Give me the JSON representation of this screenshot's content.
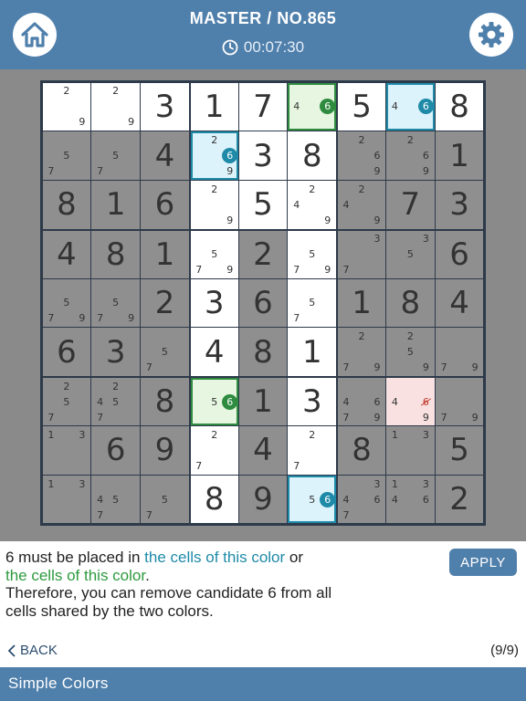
{
  "header": {
    "title": "MASTER / NO.865",
    "timer": "00:07:30",
    "home_icon": "home-icon",
    "settings_icon": "gear-icon"
  },
  "colors": {
    "header": "#4f7fab",
    "shaded_cell": "#8f8f8f",
    "white_cell": "#ffffff",
    "blue_cell": "#ddf3fb",
    "green_cell": "#e6f6e0",
    "red_cell": "#f9e1e1",
    "blue_chain": "#1f8aa8",
    "green_chain": "#2e8b3f"
  },
  "grid": [
    [
      {
        "v": "",
        "c": [
          "2",
          "9"
        ],
        "bg": "w"
      },
      {
        "v": "",
        "c": [
          "2",
          "9"
        ],
        "bg": "w"
      },
      {
        "v": "3",
        "bg": "w"
      },
      {
        "v": "1",
        "bg": "w"
      },
      {
        "v": "7",
        "bg": "w"
      },
      {
        "v": "",
        "c": [
          "4",
          "6"
        ],
        "bg": "g",
        "hl": "6",
        "hlc": "green"
      },
      {
        "v": "5",
        "bg": "w"
      },
      {
        "v": "",
        "c": [
          "4",
          "6"
        ],
        "bg": "b",
        "hl": "6",
        "hlc": "blue"
      },
      {
        "v": "8",
        "bg": "w"
      }
    ],
    [
      {
        "v": "",
        "c": [
          "5",
          "7"
        ],
        "bg": "s"
      },
      {
        "v": "",
        "c": [
          "5",
          "7"
        ],
        "bg": "s"
      },
      {
        "v": "4",
        "bg": "s"
      },
      {
        "v": "",
        "c": [
          "2",
          "6",
          "9"
        ],
        "bg": "b",
        "hl": "6",
        "hlc": "blue"
      },
      {
        "v": "3",
        "bg": "w"
      },
      {
        "v": "8",
        "bg": "w"
      },
      {
        "v": "",
        "c": [
          "2",
          "6",
          "9"
        ],
        "bg": "s"
      },
      {
        "v": "",
        "c": [
          "2",
          "6",
          "9"
        ],
        "bg": "s"
      },
      {
        "v": "1",
        "bg": "s"
      }
    ],
    [
      {
        "v": "8",
        "bg": "s"
      },
      {
        "v": "1",
        "bg": "s"
      },
      {
        "v": "6",
        "bg": "s"
      },
      {
        "v": "",
        "c": [
          "2",
          "9"
        ],
        "bg": "w"
      },
      {
        "v": "5",
        "bg": "w"
      },
      {
        "v": "",
        "c": [
          "2",
          "4",
          "9"
        ],
        "bg": "w"
      },
      {
        "v": "",
        "c": [
          "2",
          "4",
          "9"
        ],
        "bg": "s"
      },
      {
        "v": "7",
        "bg": "s"
      },
      {
        "v": "3",
        "bg": "s"
      }
    ],
    [
      {
        "v": "4",
        "bg": "s"
      },
      {
        "v": "8",
        "bg": "s"
      },
      {
        "v": "1",
        "bg": "s"
      },
      {
        "v": "",
        "c": [
          "5",
          "7",
          "9"
        ],
        "bg": "w"
      },
      {
        "v": "2",
        "bg": "s"
      },
      {
        "v": "",
        "c": [
          "5",
          "7",
          "9"
        ],
        "bg": "w"
      },
      {
        "v": "",
        "c": [
          "3",
          "7"
        ],
        "bg": "s"
      },
      {
        "v": "",
        "c": [
          "3",
          "5"
        ],
        "bg": "s"
      },
      {
        "v": "6",
        "bg": "s"
      }
    ],
    [
      {
        "v": "",
        "c": [
          "5",
          "7",
          "9"
        ],
        "bg": "s"
      },
      {
        "v": "",
        "c": [
          "5",
          "7",
          "9"
        ],
        "bg": "s"
      },
      {
        "v": "2",
        "bg": "s"
      },
      {
        "v": "3",
        "bg": "w"
      },
      {
        "v": "6",
        "bg": "s"
      },
      {
        "v": "",
        "c": [
          "5",
          "7"
        ],
        "bg": "w"
      },
      {
        "v": "1",
        "bg": "s"
      },
      {
        "v": "8",
        "bg": "s"
      },
      {
        "v": "4",
        "bg": "s"
      }
    ],
    [
      {
        "v": "6",
        "bg": "s"
      },
      {
        "v": "3",
        "bg": "s"
      },
      {
        "v": "",
        "c": [
          "5",
          "7"
        ],
        "bg": "s"
      },
      {
        "v": "4",
        "bg": "w"
      },
      {
        "v": "8",
        "bg": "s"
      },
      {
        "v": "1",
        "bg": "w"
      },
      {
        "v": "",
        "c": [
          "2",
          "7",
          "9"
        ],
        "bg": "s"
      },
      {
        "v": "",
        "c": [
          "2",
          "5",
          "9"
        ],
        "bg": "s"
      },
      {
        "v": "",
        "c": [
          "7",
          "9"
        ],
        "bg": "s"
      }
    ],
    [
      {
        "v": "",
        "c": [
          "2",
          "5",
          "7"
        ],
        "bg": "s"
      },
      {
        "v": "",
        "c": [
          "2",
          "4",
          "5",
          "7"
        ],
        "bg": "s"
      },
      {
        "v": "8",
        "bg": "s"
      },
      {
        "v": "",
        "c": [
          "5",
          "6"
        ],
        "bg": "g",
        "hl": "6",
        "hlc": "green"
      },
      {
        "v": "1",
        "bg": "s"
      },
      {
        "v": "3",
        "bg": "w"
      },
      {
        "v": "",
        "c": [
          "4",
          "6",
          "7",
          "9"
        ],
        "bg": "s"
      },
      {
        "v": "",
        "c": [
          "4",
          "6",
          "9"
        ],
        "bg": "r",
        "rm": "6"
      },
      {
        "v": "",
        "c": [
          "7",
          "9"
        ],
        "bg": "s"
      }
    ],
    [
      {
        "v": "",
        "c": [
          "1",
          "3"
        ],
        "bg": "s"
      },
      {
        "v": "6",
        "bg": "s"
      },
      {
        "v": "9",
        "bg": "s"
      },
      {
        "v": "",
        "c": [
          "2",
          "7"
        ],
        "bg": "w"
      },
      {
        "v": "4",
        "bg": "s"
      },
      {
        "v": "",
        "c": [
          "2",
          "7"
        ],
        "bg": "w"
      },
      {
        "v": "8",
        "bg": "s"
      },
      {
        "v": "",
        "c": [
          "1",
          "3"
        ],
        "bg": "s"
      },
      {
        "v": "5",
        "bg": "s"
      }
    ],
    [
      {
        "v": "",
        "c": [
          "1",
          "3"
        ],
        "bg": "s"
      },
      {
        "v": "",
        "c": [
          "4",
          "5",
          "7"
        ],
        "bg": "s"
      },
      {
        "v": "",
        "c": [
          "5",
          "7"
        ],
        "bg": "s"
      },
      {
        "v": "8",
        "bg": "w"
      },
      {
        "v": "9",
        "bg": "s"
      },
      {
        "v": "",
        "c": [
          "5",
          "6"
        ],
        "bg": "b",
        "hl": "6",
        "hlc": "blue"
      },
      {
        "v": "",
        "c": [
          "3",
          "4",
          "6",
          "7"
        ],
        "bg": "s"
      },
      {
        "v": "",
        "c": [
          "1",
          "3",
          "4",
          "6"
        ],
        "bg": "s"
      },
      {
        "v": "2",
        "bg": "s"
      }
    ]
  ],
  "hint": {
    "line1_prefix": "6 must be placed in ",
    "blue_phrase": "the cells of this color",
    "line1_suffix": " or",
    "green_phrase": "the cells of this color",
    "green_suffix": ".",
    "line3": "Therefore, you can remove candidate 6 from all",
    "line4": "cells shared by the two colors."
  },
  "apply_label": "APPLY",
  "back_label": "BACK",
  "step": "(9/9)",
  "footer_label": "Simple Colors"
}
